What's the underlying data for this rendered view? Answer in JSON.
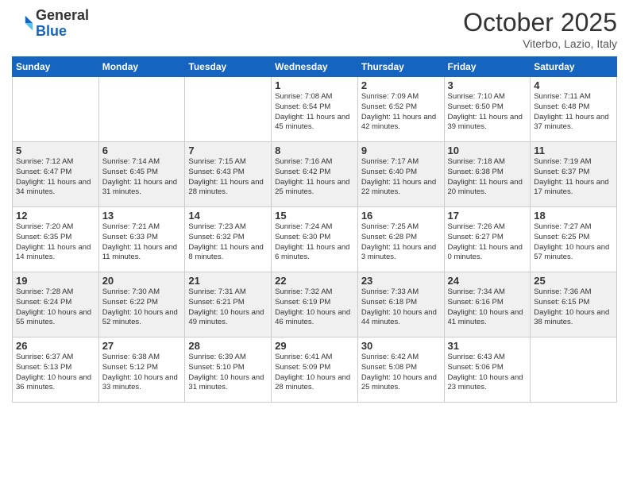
{
  "logo": {
    "general": "General",
    "blue": "Blue"
  },
  "title": {
    "month": "October 2025",
    "location": "Viterbo, Lazio, Italy"
  },
  "days_header": [
    "Sunday",
    "Monday",
    "Tuesday",
    "Wednesday",
    "Thursday",
    "Friday",
    "Saturday"
  ],
  "weeks": [
    {
      "row_style": "normal",
      "days": [
        {
          "num": "",
          "info": ""
        },
        {
          "num": "",
          "info": ""
        },
        {
          "num": "",
          "info": ""
        },
        {
          "num": "1",
          "info": "Sunrise: 7:08 AM\nSunset: 6:54 PM\nDaylight: 11 hours and 45 minutes."
        },
        {
          "num": "2",
          "info": "Sunrise: 7:09 AM\nSunset: 6:52 PM\nDaylight: 11 hours and 42 minutes."
        },
        {
          "num": "3",
          "info": "Sunrise: 7:10 AM\nSunset: 6:50 PM\nDaylight: 11 hours and 39 minutes."
        },
        {
          "num": "4",
          "info": "Sunrise: 7:11 AM\nSunset: 6:48 PM\nDaylight: 11 hours and 37 minutes."
        }
      ]
    },
    {
      "row_style": "alt",
      "days": [
        {
          "num": "5",
          "info": "Sunrise: 7:12 AM\nSunset: 6:47 PM\nDaylight: 11 hours and 34 minutes."
        },
        {
          "num": "6",
          "info": "Sunrise: 7:14 AM\nSunset: 6:45 PM\nDaylight: 11 hours and 31 minutes."
        },
        {
          "num": "7",
          "info": "Sunrise: 7:15 AM\nSunset: 6:43 PM\nDaylight: 11 hours and 28 minutes."
        },
        {
          "num": "8",
          "info": "Sunrise: 7:16 AM\nSunset: 6:42 PM\nDaylight: 11 hours and 25 minutes."
        },
        {
          "num": "9",
          "info": "Sunrise: 7:17 AM\nSunset: 6:40 PM\nDaylight: 11 hours and 22 minutes."
        },
        {
          "num": "10",
          "info": "Sunrise: 7:18 AM\nSunset: 6:38 PM\nDaylight: 11 hours and 20 minutes."
        },
        {
          "num": "11",
          "info": "Sunrise: 7:19 AM\nSunset: 6:37 PM\nDaylight: 11 hours and 17 minutes."
        }
      ]
    },
    {
      "row_style": "normal",
      "days": [
        {
          "num": "12",
          "info": "Sunrise: 7:20 AM\nSunset: 6:35 PM\nDaylight: 11 hours and 14 minutes."
        },
        {
          "num": "13",
          "info": "Sunrise: 7:21 AM\nSunset: 6:33 PM\nDaylight: 11 hours and 11 minutes."
        },
        {
          "num": "14",
          "info": "Sunrise: 7:23 AM\nSunset: 6:32 PM\nDaylight: 11 hours and 8 minutes."
        },
        {
          "num": "15",
          "info": "Sunrise: 7:24 AM\nSunset: 6:30 PM\nDaylight: 11 hours and 6 minutes."
        },
        {
          "num": "16",
          "info": "Sunrise: 7:25 AM\nSunset: 6:28 PM\nDaylight: 11 hours and 3 minutes."
        },
        {
          "num": "17",
          "info": "Sunrise: 7:26 AM\nSunset: 6:27 PM\nDaylight: 11 hours and 0 minutes."
        },
        {
          "num": "18",
          "info": "Sunrise: 7:27 AM\nSunset: 6:25 PM\nDaylight: 10 hours and 57 minutes."
        }
      ]
    },
    {
      "row_style": "alt",
      "days": [
        {
          "num": "19",
          "info": "Sunrise: 7:28 AM\nSunset: 6:24 PM\nDaylight: 10 hours and 55 minutes."
        },
        {
          "num": "20",
          "info": "Sunrise: 7:30 AM\nSunset: 6:22 PM\nDaylight: 10 hours and 52 minutes."
        },
        {
          "num": "21",
          "info": "Sunrise: 7:31 AM\nSunset: 6:21 PM\nDaylight: 10 hours and 49 minutes."
        },
        {
          "num": "22",
          "info": "Sunrise: 7:32 AM\nSunset: 6:19 PM\nDaylight: 10 hours and 46 minutes."
        },
        {
          "num": "23",
          "info": "Sunrise: 7:33 AM\nSunset: 6:18 PM\nDaylight: 10 hours and 44 minutes."
        },
        {
          "num": "24",
          "info": "Sunrise: 7:34 AM\nSunset: 6:16 PM\nDaylight: 10 hours and 41 minutes."
        },
        {
          "num": "25",
          "info": "Sunrise: 7:36 AM\nSunset: 6:15 PM\nDaylight: 10 hours and 38 minutes."
        }
      ]
    },
    {
      "row_style": "normal",
      "days": [
        {
          "num": "26",
          "info": "Sunrise: 6:37 AM\nSunset: 5:13 PM\nDaylight: 10 hours and 36 minutes."
        },
        {
          "num": "27",
          "info": "Sunrise: 6:38 AM\nSunset: 5:12 PM\nDaylight: 10 hours and 33 minutes."
        },
        {
          "num": "28",
          "info": "Sunrise: 6:39 AM\nSunset: 5:10 PM\nDaylight: 10 hours and 31 minutes."
        },
        {
          "num": "29",
          "info": "Sunrise: 6:41 AM\nSunset: 5:09 PM\nDaylight: 10 hours and 28 minutes."
        },
        {
          "num": "30",
          "info": "Sunrise: 6:42 AM\nSunset: 5:08 PM\nDaylight: 10 hours and 25 minutes."
        },
        {
          "num": "31",
          "info": "Sunrise: 6:43 AM\nSunset: 5:06 PM\nDaylight: 10 hours and 23 minutes."
        },
        {
          "num": "",
          "info": ""
        }
      ]
    }
  ]
}
